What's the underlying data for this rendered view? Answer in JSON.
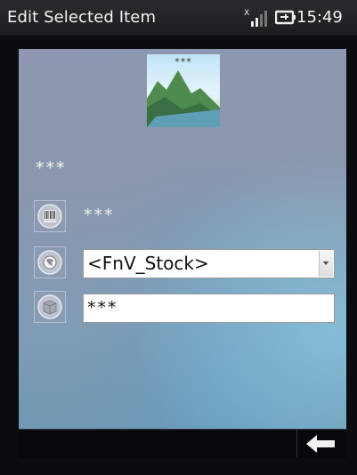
{
  "statusbar": {
    "title": "Edit Selected Item",
    "time": "15:49",
    "signal_icon": "no-signal-icon",
    "battery_icon": "charging-battery-icon"
  },
  "item": {
    "picture_caption": "***",
    "name": "***",
    "barcode": "***",
    "stock_location": "<FnV_Stock>",
    "quantity": "***"
  },
  "icons": {
    "barcode": "barcode-icon",
    "location": "location-icon",
    "quantity": "box-icon",
    "back": "back-arrow-icon"
  }
}
